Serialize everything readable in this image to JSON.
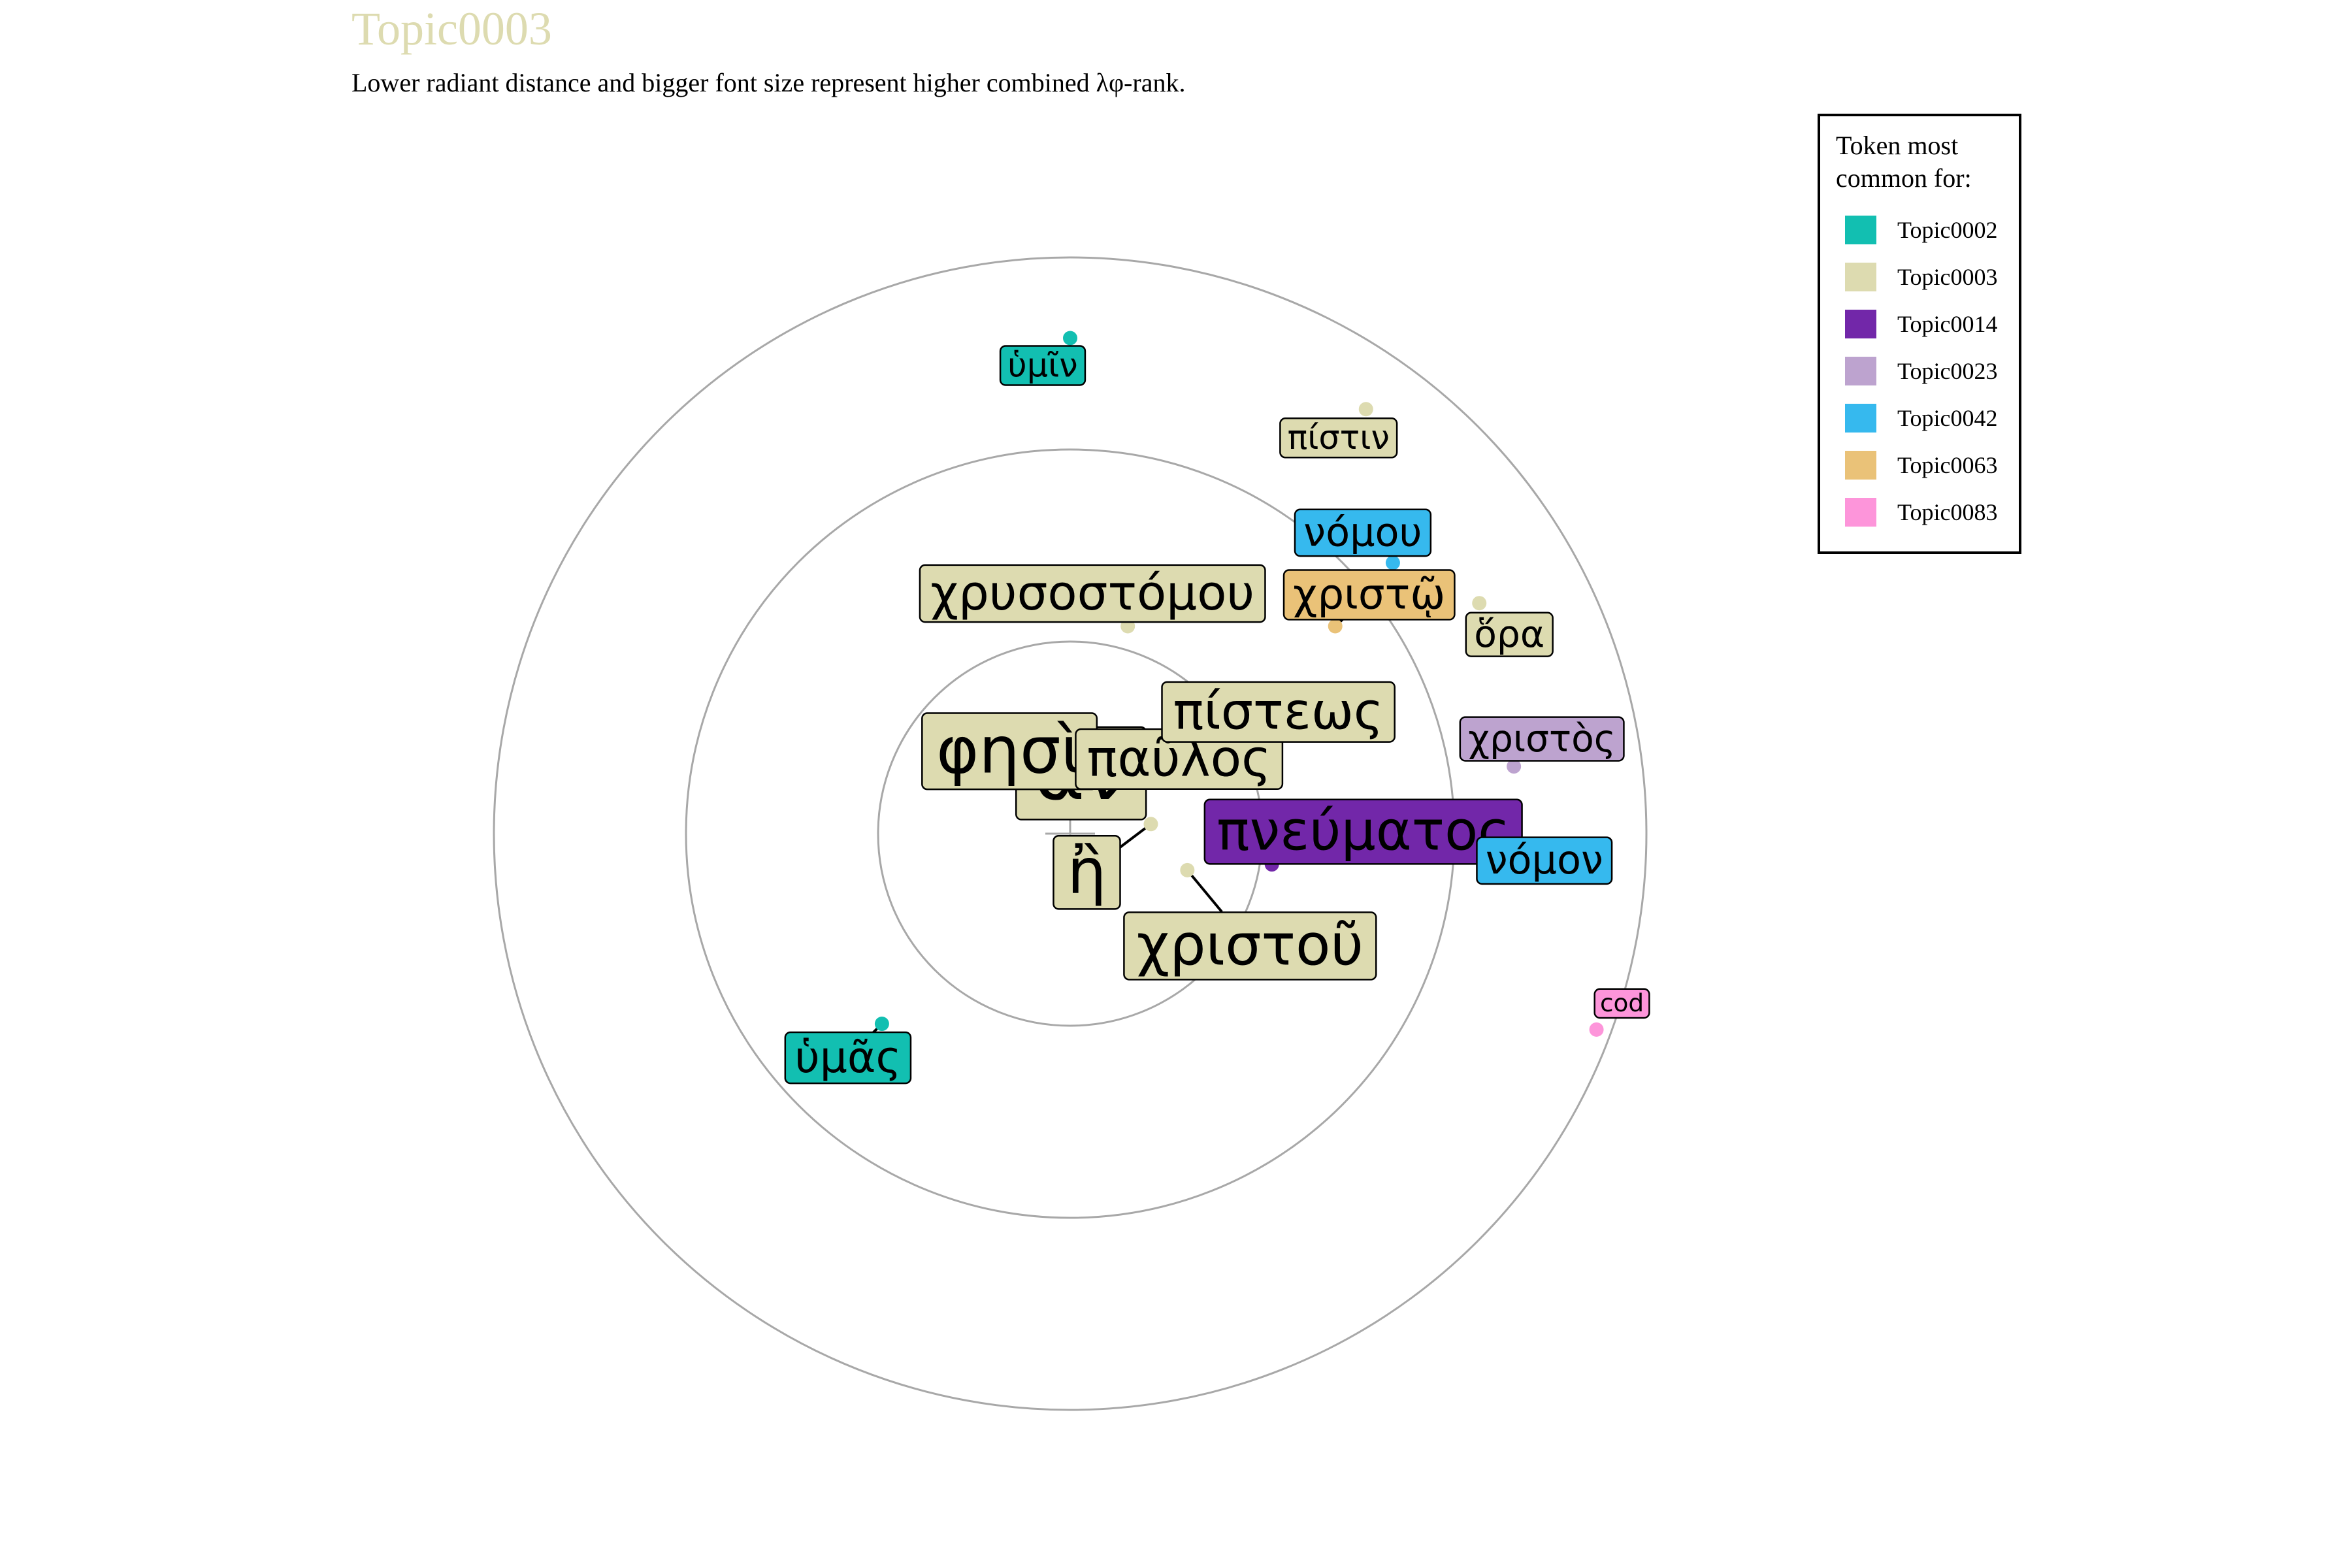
{
  "chart_data": {
    "type": "scatter",
    "title": "Topic0003",
    "subtitle": "Lower radiant distance and bigger font size represent higher combined λφ-rank.",
    "title_color": "#DDDBB0",
    "legend": {
      "title_line1": "Token most",
      "title_line2": "common for:",
      "position": "right",
      "entries": [
        {
          "name": "Topic0002",
          "color": "#12BFB1"
        },
        {
          "name": "Topic0003",
          "color": "#DDDBB0"
        },
        {
          "name": "Topic0014",
          "color": "#7227A9"
        },
        {
          "name": "Topic0023",
          "color": "#BDA3CF"
        },
        {
          "name": "Topic0042",
          "color": "#36B9EE"
        },
        {
          "name": "Topic0063",
          "color": "#EAC278"
        },
        {
          "name": "Topic0083",
          "color": "#FD95DA"
        }
      ]
    },
    "rings": [
      1,
      2,
      3
    ],
    "center": [
      0,
      0
    ],
    "tokens": [
      {
        "label": "ἂν",
        "topic": "Topic0003",
        "x": 0.05,
        "y": 0.27,
        "size": 1.0
      },
      {
        "label": "φησὶ",
        "topic": "Topic0003",
        "x": -0.18,
        "y": 0.47,
        "size": 0.78
      },
      {
        "label": "ἢ",
        "topic": "Topic0003",
        "x": 0.42,
        "y": 0.05,
        "size": 0.74
      },
      {
        "label": "παῦλος",
        "topic": "Topic0003",
        "x": 0.22,
        "y": 0.32,
        "size": 0.56
      },
      {
        "label": "χριστοῦ",
        "topic": "Topic0003",
        "x": 0.61,
        "y": -0.19,
        "size": 0.66
      },
      {
        "label": "πίστεως",
        "topic": "Topic0003",
        "x": 0.9,
        "y": 0.45,
        "size": 0.56
      },
      {
        "label": "χρυσοστόμου",
        "topic": "Topic0003",
        "x": 0.3,
        "y": 1.08,
        "size": 0.52
      },
      {
        "label": "πνεύματος",
        "topic": "Topic0014",
        "x": 1.05,
        "y": -0.16,
        "size": 0.62
      },
      {
        "label": "χριστῷ",
        "topic": "Topic0063",
        "x": 1.38,
        "y": 1.08,
        "size": 0.42
      },
      {
        "label": "νόμου",
        "topic": "Topic0042",
        "x": 1.68,
        "y": 1.41,
        "size": 0.38
      },
      {
        "label": "νόμον",
        "topic": "Topic0042",
        "x": 2.04,
        "y": -0.12,
        "size": 0.38
      },
      {
        "label": "ὅρα",
        "topic": "Topic0003",
        "x": 2.13,
        "y": 1.2,
        "size": 0.34
      },
      {
        "label": "χριστὸς",
        "topic": "Topic0023",
        "x": 2.31,
        "y": 0.35,
        "size": 0.34
      },
      {
        "label": "πίστιν",
        "topic": "Topic0003",
        "x": 1.54,
        "y": 2.21,
        "size": 0.28
      },
      {
        "label": "ὑμῖν",
        "topic": "Topic0002",
        "x": 0.0,
        "y": 2.58,
        "size": 0.28
      },
      {
        "label": "ὑμᾶς",
        "topic": "Topic0002",
        "x": -0.98,
        "y": -0.99,
        "size": 0.44
      },
      {
        "label": "cod",
        "topic": "Topic0083",
        "x": 2.74,
        "y": -1.02,
        "size": 0.14
      }
    ]
  }
}
